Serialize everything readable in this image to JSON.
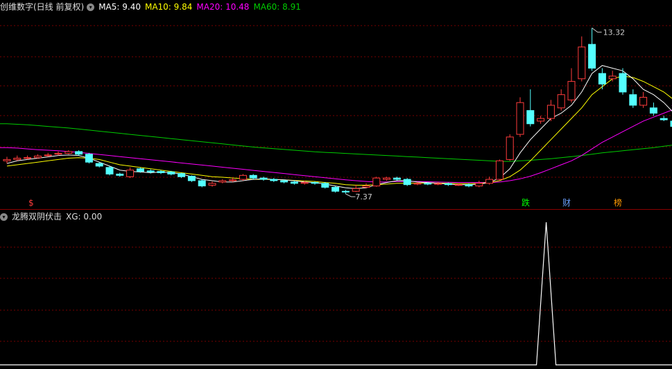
{
  "main_header": {
    "title": "创维数字(日线 前复权)",
    "ma5_label": "MA5: 9.40",
    "ma10_label": "MA10: 9.84",
    "ma20_label": "MA20: 10.48",
    "ma60_label": "MA60: 8.91"
  },
  "indicator_header": {
    "title": "龙腾双阴伏击",
    "xg_label": "XG: 0.00"
  },
  "colors": {
    "up": "#ff3c3c",
    "down": "#54ffff",
    "ma5": "#ffffff",
    "ma10": "#ffff00",
    "ma20": "#ff00ff",
    "ma60": "#00cc00",
    "grid": "#7a0000"
  },
  "badges": [
    {
      "text": "$",
      "color": "#ff3c3c"
    },
    {
      "text": "跌",
      "color": "#00ff00"
    },
    {
      "text": "财",
      "color": "#6aa0ff"
    },
    {
      "text": "榜",
      "color": "#ff9900"
    }
  ],
  "annotations": {
    "high_label": "13.32",
    "low_label": "7.37"
  },
  "chart_data": {
    "type": "candlestick",
    "ylim": [
      7.0,
      13.8
    ],
    "candles": [
      [
        8.3,
        8.35,
        8.45,
        8.2
      ],
      [
        8.35,
        8.4,
        8.5,
        8.3
      ],
      [
        8.4,
        8.42,
        8.5,
        8.35
      ],
      [
        8.42,
        8.48,
        8.55,
        8.38
      ],
      [
        8.5,
        8.52,
        8.6,
        8.45
      ],
      [
        8.55,
        8.58,
        8.65,
        8.5
      ],
      [
        8.58,
        8.65,
        8.7,
        8.55
      ],
      [
        8.65,
        8.55,
        8.7,
        8.5
      ],
      [
        8.55,
        8.25,
        8.6,
        8.2
      ],
      [
        8.2,
        8.1,
        8.25,
        8.05
      ],
      [
        8.05,
        7.8,
        8.1,
        7.75
      ],
      [
        7.8,
        7.75,
        7.85,
        7.7
      ],
      [
        7.7,
        7.95,
        8.05,
        7.65
      ],
      [
        8.0,
        7.9,
        8.05,
        7.85
      ],
      [
        7.92,
        7.88,
        7.98,
        7.82
      ],
      [
        7.9,
        7.85,
        7.95,
        7.8
      ],
      [
        7.88,
        7.8,
        7.92,
        7.75
      ],
      [
        7.82,
        7.7,
        7.85,
        7.65
      ],
      [
        7.72,
        7.55,
        7.75,
        7.5
      ],
      [
        7.55,
        7.35,
        7.6,
        7.3
      ],
      [
        7.38,
        7.45,
        7.52,
        7.32
      ],
      [
        7.5,
        7.55,
        7.6,
        7.45
      ],
      [
        7.55,
        7.58,
        7.65,
        7.5
      ],
      [
        7.6,
        7.75,
        7.8,
        7.55
      ],
      [
        7.75,
        7.65,
        7.8,
        7.6
      ],
      [
        7.65,
        7.6,
        7.7,
        7.55
      ],
      [
        7.6,
        7.55,
        7.65,
        7.5
      ],
      [
        7.55,
        7.5,
        7.6,
        7.45
      ],
      [
        7.5,
        7.45,
        7.55,
        7.4
      ],
      [
        7.45,
        7.48,
        7.55,
        7.4
      ],
      [
        7.48,
        7.45,
        7.52,
        7.4
      ],
      [
        7.45,
        7.3,
        7.5,
        7.25
      ],
      [
        7.3,
        7.15,
        7.35,
        7.1
      ],
      [
        7.15,
        7.12,
        7.2,
        7.05
      ],
      [
        7.15,
        7.25,
        7.4,
        7.12
      ],
      [
        7.3,
        7.35,
        7.45,
        7.28
      ],
      [
        7.35,
        7.65,
        7.7,
        7.32
      ],
      [
        7.6,
        7.65,
        7.7,
        7.55
      ],
      [
        7.65,
        7.6,
        7.7,
        7.55
      ],
      [
        7.6,
        7.4,
        7.65,
        7.35
      ],
      [
        7.42,
        7.45,
        7.5,
        7.38
      ],
      [
        7.45,
        7.42,
        7.5,
        7.38
      ],
      [
        7.42,
        7.44,
        7.5,
        7.38
      ],
      [
        7.44,
        7.4,
        7.48,
        7.35
      ],
      [
        7.4,
        7.4,
        7.45,
        7.35
      ],
      [
        7.4,
        7.35,
        7.45,
        7.3
      ],
      [
        7.35,
        7.45,
        7.55,
        7.3
      ],
      [
        7.45,
        7.6,
        7.7,
        7.4
      ],
      [
        7.6,
        8.3,
        8.35,
        7.55
      ],
      [
        8.35,
        9.2,
        9.3,
        8.3
      ],
      [
        9.3,
        10.5,
        10.7,
        9.2
      ],
      [
        10.2,
        9.7,
        11.0,
        9.6
      ],
      [
        9.8,
        9.9,
        10.0,
        9.7
      ],
      [
        9.9,
        10.4,
        10.6,
        9.8
      ],
      [
        10.3,
        10.8,
        11.0,
        10.2
      ],
      [
        10.6,
        11.3,
        11.8,
        10.5
      ],
      [
        11.4,
        12.6,
        13.0,
        11.3
      ],
      [
        12.7,
        11.8,
        13.32,
        11.7
      ],
      [
        11.6,
        11.2,
        11.8,
        11.0
      ],
      [
        11.4,
        11.5,
        11.7,
        11.3
      ],
      [
        11.6,
        10.9,
        11.8,
        10.8
      ],
      [
        10.8,
        10.4,
        11.0,
        10.3
      ],
      [
        10.4,
        10.7,
        10.9,
        10.3
      ],
      [
        10.3,
        10.1,
        10.5,
        10.0
      ],
      [
        9.9,
        9.85,
        10.0,
        9.8
      ],
      [
        9.8,
        9.6,
        9.95,
        9.4
      ]
    ],
    "ma5": [
      8.2,
      8.3,
      8.35,
      8.4,
      8.45,
      8.5,
      8.52,
      8.5,
      8.4,
      8.25,
      8.1,
      7.95,
      7.9,
      7.88,
      7.85,
      7.88,
      7.85,
      7.8,
      7.7,
      7.6,
      7.55,
      7.5,
      7.5,
      7.55,
      7.6,
      7.62,
      7.6,
      7.58,
      7.55,
      7.5,
      7.48,
      7.42,
      7.35,
      7.28,
      7.25,
      7.28,
      7.4,
      7.48,
      7.55,
      7.55,
      7.5,
      7.48,
      7.45,
      7.42,
      7.4,
      7.4,
      7.42,
      7.48,
      7.65,
      8.0,
      8.6,
      9.1,
      9.5,
      9.9,
      10.1,
      10.4,
      10.9,
      11.6,
      11.9,
      11.8,
      11.7,
      11.4,
      11.0,
      10.8,
      10.5,
      10.1
    ],
    "ma10": [
      8.1,
      8.15,
      8.2,
      8.25,
      8.3,
      8.35,
      8.4,
      8.42,
      8.4,
      8.35,
      8.25,
      8.15,
      8.1,
      8.05,
      8.0,
      7.95,
      7.9,
      7.85,
      7.8,
      7.75,
      7.7,
      7.68,
      7.65,
      7.62,
      7.6,
      7.6,
      7.6,
      7.58,
      7.56,
      7.54,
      7.52,
      7.48,
      7.45,
      7.4,
      7.38,
      7.38,
      7.4,
      7.42,
      7.45,
      7.45,
      7.46,
      7.46,
      7.46,
      7.45,
      7.44,
      7.44,
      7.45,
      7.48,
      7.55,
      7.7,
      7.95,
      8.3,
      8.7,
      9.1,
      9.5,
      9.9,
      10.3,
      10.8,
      11.1,
      11.4,
      11.5,
      11.45,
      11.3,
      11.1,
      10.9,
      10.6
    ],
    "ma20": [
      8.8,
      8.78,
      8.75,
      8.72,
      8.7,
      8.68,
      8.65,
      8.62,
      8.58,
      8.54,
      8.5,
      8.46,
      8.42,
      8.38,
      8.34,
      8.3,
      8.26,
      8.22,
      8.18,
      8.14,
      8.1,
      8.06,
      8.02,
      7.98,
      7.94,
      7.9,
      7.86,
      7.82,
      7.78,
      7.74,
      7.7,
      7.66,
      7.62,
      7.58,
      7.55,
      7.52,
      7.5,
      7.5,
      7.52,
      7.52,
      7.52,
      7.51,
      7.5,
      7.49,
      7.48,
      7.48,
      7.48,
      7.48,
      7.5,
      7.55,
      7.62,
      7.72,
      7.85,
      8.0,
      8.15,
      8.3,
      8.5,
      8.75,
      9.0,
      9.2,
      9.4,
      9.6,
      9.8,
      9.95,
      10.1,
      10.25
    ],
    "ma60": [
      9.7,
      9.68,
      9.66,
      9.63,
      9.6,
      9.57,
      9.54,
      9.5,
      9.46,
      9.42,
      9.38,
      9.34,
      9.3,
      9.26,
      9.22,
      9.18,
      9.14,
      9.1,
      9.06,
      9.02,
      8.98,
      8.94,
      8.9,
      8.86,
      8.82,
      8.79,
      8.76,
      8.73,
      8.7,
      8.67,
      8.64,
      8.62,
      8.6,
      8.58,
      8.56,
      8.54,
      8.52,
      8.5,
      8.48,
      8.46,
      8.44,
      8.42,
      8.4,
      8.38,
      8.36,
      8.34,
      8.32,
      8.3,
      8.28,
      8.28,
      8.3,
      8.32,
      8.35,
      8.38,
      8.42,
      8.46,
      8.5,
      8.55,
      8.6,
      8.64,
      8.68,
      8.72,
      8.76,
      8.8,
      8.85,
      8.9
    ],
    "xg": [
      0,
      0,
      0,
      0,
      0,
      0,
      0,
      0,
      0,
      0,
      0,
      0,
      0,
      0,
      0,
      0,
      0,
      0,
      0,
      0,
      0,
      0,
      0,
      0,
      0,
      0,
      0,
      0,
      0,
      0,
      0,
      0,
      0,
      0,
      0,
      0,
      0,
      0,
      0,
      0,
      0,
      0,
      0,
      0,
      0,
      0,
      0,
      0,
      0,
      0,
      0,
      0,
      1,
      0,
      0,
      0,
      0,
      0,
      0,
      0,
      0,
      0,
      0,
      0,
      0,
      0
    ]
  }
}
